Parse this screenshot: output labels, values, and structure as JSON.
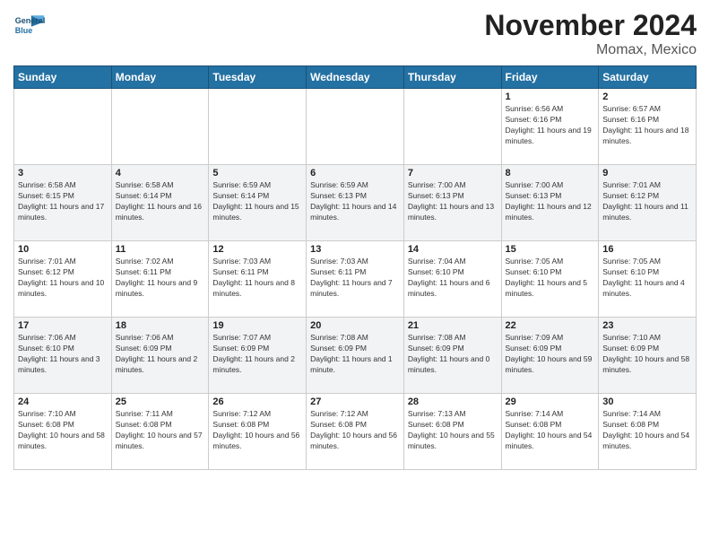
{
  "header": {
    "logo_line1": "General",
    "logo_line2": "Blue",
    "month_title": "November 2024",
    "location": "Momax, Mexico"
  },
  "weekdays": [
    "Sunday",
    "Monday",
    "Tuesday",
    "Wednesday",
    "Thursday",
    "Friday",
    "Saturday"
  ],
  "weeks": [
    [
      {
        "day": "",
        "info": ""
      },
      {
        "day": "",
        "info": ""
      },
      {
        "day": "",
        "info": ""
      },
      {
        "day": "",
        "info": ""
      },
      {
        "day": "",
        "info": ""
      },
      {
        "day": "1",
        "info": "Sunrise: 6:56 AM\nSunset: 6:16 PM\nDaylight: 11 hours and 19 minutes."
      },
      {
        "day": "2",
        "info": "Sunrise: 6:57 AM\nSunset: 6:16 PM\nDaylight: 11 hours and 18 minutes."
      }
    ],
    [
      {
        "day": "3",
        "info": "Sunrise: 6:58 AM\nSunset: 6:15 PM\nDaylight: 11 hours and 17 minutes."
      },
      {
        "day": "4",
        "info": "Sunrise: 6:58 AM\nSunset: 6:14 PM\nDaylight: 11 hours and 16 minutes."
      },
      {
        "day": "5",
        "info": "Sunrise: 6:59 AM\nSunset: 6:14 PM\nDaylight: 11 hours and 15 minutes."
      },
      {
        "day": "6",
        "info": "Sunrise: 6:59 AM\nSunset: 6:13 PM\nDaylight: 11 hours and 14 minutes."
      },
      {
        "day": "7",
        "info": "Sunrise: 7:00 AM\nSunset: 6:13 PM\nDaylight: 11 hours and 13 minutes."
      },
      {
        "day": "8",
        "info": "Sunrise: 7:00 AM\nSunset: 6:13 PM\nDaylight: 11 hours and 12 minutes."
      },
      {
        "day": "9",
        "info": "Sunrise: 7:01 AM\nSunset: 6:12 PM\nDaylight: 11 hours and 11 minutes."
      }
    ],
    [
      {
        "day": "10",
        "info": "Sunrise: 7:01 AM\nSunset: 6:12 PM\nDaylight: 11 hours and 10 minutes."
      },
      {
        "day": "11",
        "info": "Sunrise: 7:02 AM\nSunset: 6:11 PM\nDaylight: 11 hours and 9 minutes."
      },
      {
        "day": "12",
        "info": "Sunrise: 7:03 AM\nSunset: 6:11 PM\nDaylight: 11 hours and 8 minutes."
      },
      {
        "day": "13",
        "info": "Sunrise: 7:03 AM\nSunset: 6:11 PM\nDaylight: 11 hours and 7 minutes."
      },
      {
        "day": "14",
        "info": "Sunrise: 7:04 AM\nSunset: 6:10 PM\nDaylight: 11 hours and 6 minutes."
      },
      {
        "day": "15",
        "info": "Sunrise: 7:05 AM\nSunset: 6:10 PM\nDaylight: 11 hours and 5 minutes."
      },
      {
        "day": "16",
        "info": "Sunrise: 7:05 AM\nSunset: 6:10 PM\nDaylight: 11 hours and 4 minutes."
      }
    ],
    [
      {
        "day": "17",
        "info": "Sunrise: 7:06 AM\nSunset: 6:10 PM\nDaylight: 11 hours and 3 minutes."
      },
      {
        "day": "18",
        "info": "Sunrise: 7:06 AM\nSunset: 6:09 PM\nDaylight: 11 hours and 2 minutes."
      },
      {
        "day": "19",
        "info": "Sunrise: 7:07 AM\nSunset: 6:09 PM\nDaylight: 11 hours and 2 minutes."
      },
      {
        "day": "20",
        "info": "Sunrise: 7:08 AM\nSunset: 6:09 PM\nDaylight: 11 hours and 1 minute."
      },
      {
        "day": "21",
        "info": "Sunrise: 7:08 AM\nSunset: 6:09 PM\nDaylight: 11 hours and 0 minutes."
      },
      {
        "day": "22",
        "info": "Sunrise: 7:09 AM\nSunset: 6:09 PM\nDaylight: 10 hours and 59 minutes."
      },
      {
        "day": "23",
        "info": "Sunrise: 7:10 AM\nSunset: 6:09 PM\nDaylight: 10 hours and 58 minutes."
      }
    ],
    [
      {
        "day": "24",
        "info": "Sunrise: 7:10 AM\nSunset: 6:08 PM\nDaylight: 10 hours and 58 minutes."
      },
      {
        "day": "25",
        "info": "Sunrise: 7:11 AM\nSunset: 6:08 PM\nDaylight: 10 hours and 57 minutes."
      },
      {
        "day": "26",
        "info": "Sunrise: 7:12 AM\nSunset: 6:08 PM\nDaylight: 10 hours and 56 minutes."
      },
      {
        "day": "27",
        "info": "Sunrise: 7:12 AM\nSunset: 6:08 PM\nDaylight: 10 hours and 56 minutes."
      },
      {
        "day": "28",
        "info": "Sunrise: 7:13 AM\nSunset: 6:08 PM\nDaylight: 10 hours and 55 minutes."
      },
      {
        "day": "29",
        "info": "Sunrise: 7:14 AM\nSunset: 6:08 PM\nDaylight: 10 hours and 54 minutes."
      },
      {
        "day": "30",
        "info": "Sunrise: 7:14 AM\nSunset: 6:08 PM\nDaylight: 10 hours and 54 minutes."
      }
    ]
  ]
}
